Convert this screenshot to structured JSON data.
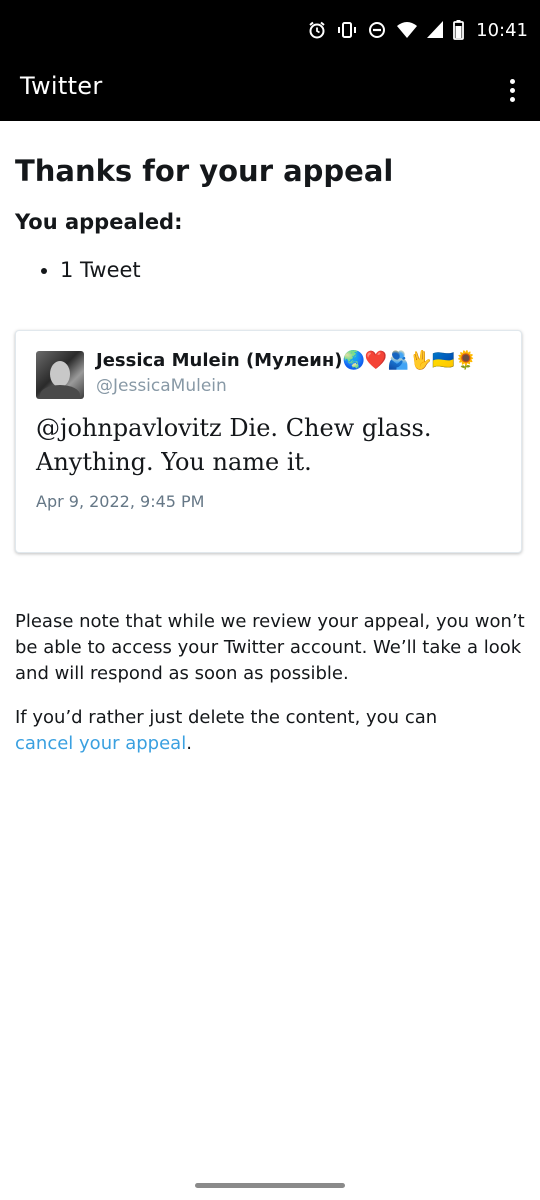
{
  "status_bar": {
    "time": "10:41",
    "icons": [
      "alarm-icon",
      "vibrate-icon",
      "do-not-disturb-icon",
      "wifi-icon",
      "cellular-signal-icon",
      "battery-icon"
    ]
  },
  "app_bar": {
    "title": "Twitter",
    "menu_icon": "overflow-menu-icon"
  },
  "main": {
    "title": "Thanks for your appeal",
    "appealed_label": "You appealed:",
    "appealed_items": [
      "1 Tweet"
    ]
  },
  "tweet": {
    "author_name": "Jessica Mulein (Мулеин)🌏❤️🫂🖖🇺🇦🌻",
    "author_handle": "@JessicaMulein",
    "text": "@johnpavlovitz Die. Chew glass. Anything. You name it.",
    "timestamp": "Apr 9, 2022, 9:45 PM"
  },
  "note": {
    "review_text": "Please note that while we review your appeal, you won’t be able to access your Twitter account. We’ll take a look and will respond as soon as possible.",
    "cancel_prefix": "If you’d rather just delete the content, you can",
    "cancel_link": "cancel your appeal",
    "cancel_suffix": "."
  },
  "colors": {
    "app_bar_bg": "#000000",
    "link": "#3aa0e0",
    "handle": "#8899a6",
    "text": "#14171a"
  }
}
